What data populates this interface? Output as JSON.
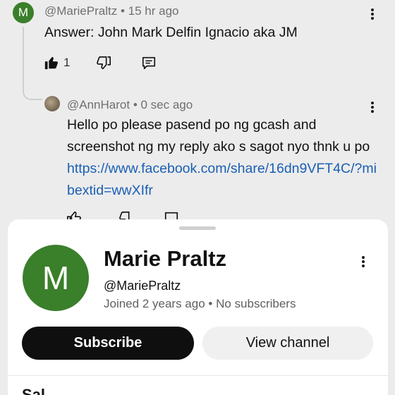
{
  "comment1": {
    "avatar_letter": "M",
    "author": "@MariePraltz",
    "time": "15 hr ago",
    "text": "Answer: John Mark Delfin Ignacio aka  JM",
    "likes": "1"
  },
  "comment2": {
    "author": "@AnnHarot",
    "time": "0 sec ago",
    "text": "Hello po please pasend po ng gcash and screenshot ng  my reply ako s sagot nyo thnk u po ",
    "link": "https://www.facebook.com/share/16dn9VFT4C/?mibextid=wwXIfr"
  },
  "separator": "•",
  "profile_sheet": {
    "avatar_letter": "M",
    "name": "Marie Praltz",
    "handle": "@MariePraltz",
    "joined": "Joined 2 years ago",
    "subscribers": "No subscribers",
    "subscribe_label": "Subscribe",
    "view_channel_label": "View channel",
    "next_section_partial": "Sal..."
  },
  "colors": {
    "avatar_green": "#3a7f2a",
    "link_blue": "#1a5fb4",
    "overlay_gray": "#ececec"
  }
}
